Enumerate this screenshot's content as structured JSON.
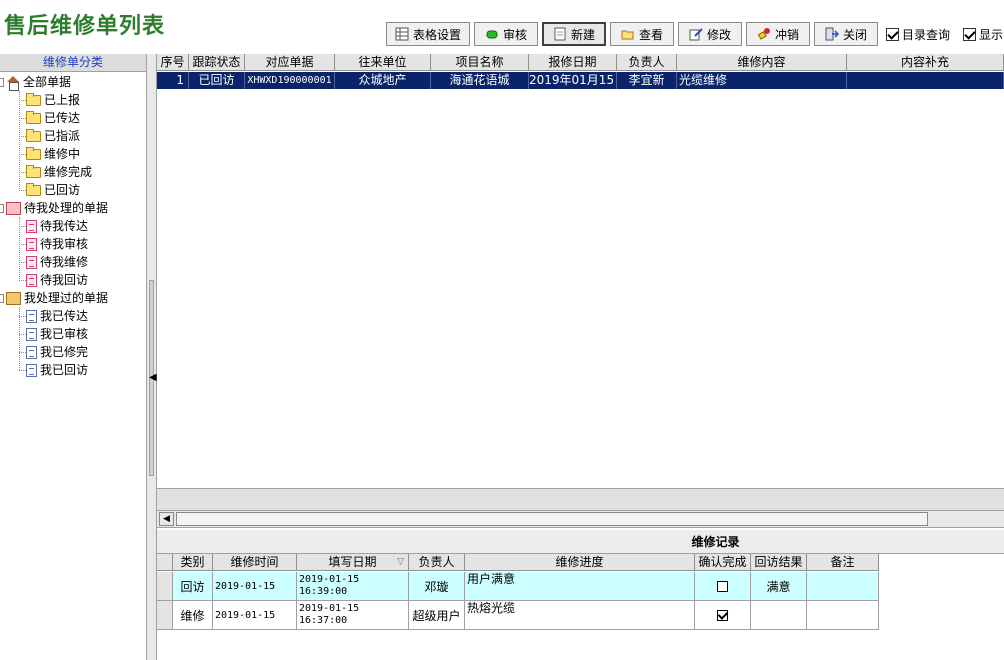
{
  "title": "售后维修单列表",
  "toolbar": {
    "buttons": [
      {
        "label": "表格设置",
        "icon": "grid-settings-icon"
      },
      {
        "label": "审核",
        "icon": "green-dot-icon"
      },
      {
        "label": "新建",
        "icon": "new-doc-icon"
      },
      {
        "label": "查看",
        "icon": "open-folder-icon"
      },
      {
        "label": "修改",
        "icon": "edit-icon"
      },
      {
        "label": "冲销",
        "icon": "eraser-icon"
      },
      {
        "label": "关闭",
        "icon": "exit-icon"
      }
    ],
    "checks": [
      {
        "label": "目录查询",
        "checked": true
      },
      {
        "label": "显示",
        "checked": true
      }
    ]
  },
  "tree": {
    "header": "维修单分类",
    "groups": [
      {
        "label": "全部单据",
        "icon": "home-icon",
        "items": [
          "已上报",
          "已传达",
          "已指派",
          "维修中",
          "维修完成",
          "已回访"
        ]
      },
      {
        "label": "待我处理的单据",
        "icon": "red-tray-icon",
        "items": [
          "待我传达",
          "待我审核",
          "待我维修",
          "待我回访"
        ]
      },
      {
        "label": "我处理过的单据",
        "icon": "tray-icon",
        "items": [
          "我已传达",
          "我已审核",
          "我已修完",
          "我已回访"
        ]
      }
    ]
  },
  "grid": {
    "columns": [
      "序号",
      "跟踪状态",
      "对应单据",
      "往来单位",
      "项目名称",
      "报修日期",
      "负责人",
      "维修内容",
      "内容补充"
    ],
    "rows": [
      [
        "1",
        "已回访",
        "XHWXD190000001",
        "众城地产",
        "海通花语城",
        "2019年01月15日",
        "李宜新",
        "光缆维修",
        ""
      ]
    ]
  },
  "records": {
    "title": "维修记录",
    "columns": [
      "类别",
      "维修时间",
      "填写日期",
      "负责人",
      "维修进度",
      "确认完成",
      "回访结果",
      "备注"
    ],
    "rows": [
      {
        "type": "回访",
        "time": "2019-01-15",
        "date": "2019-01-15",
        "clock": "16:39:00",
        "person": "邓璇",
        "progress": "用户满意",
        "confirmed": false,
        "result": "满意",
        "note": ""
      },
      {
        "type": "维修",
        "time": "2019-01-15",
        "date": "2019-01-15",
        "clock": "16:37:00",
        "person": "超级用户",
        "progress": "热熔光缆",
        "confirmed": true,
        "result": "",
        "note": ""
      }
    ]
  },
  "colors": {
    "title": "#2e7d2e",
    "selection": "#0a246a",
    "highlight_row": "#ccffff",
    "tree_header": "#2040c0"
  }
}
